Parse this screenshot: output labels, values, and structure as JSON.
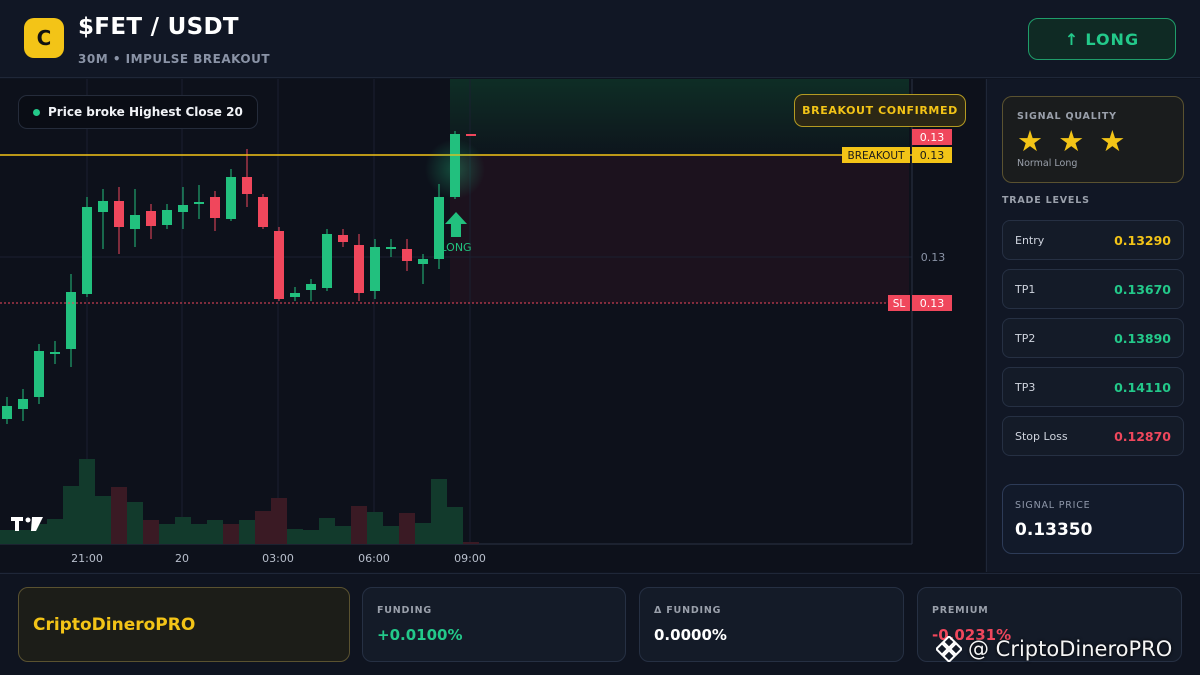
{
  "header": {
    "logo_letter": "C",
    "pair": "$FET / USDT",
    "subtitle": "30M • IMPULSE BREAKOUT",
    "long_button": "LONG",
    "long_icon": "arrow-up-icon"
  },
  "chart": {
    "signal_pill": "Price broke Highest Close 20",
    "breakout_badge": "BREAKOUT CONFIRMED",
    "long_marker_label": "LONG",
    "level_tags": {
      "top_price": "0.13",
      "breakout_label": "BREAKOUT",
      "breakout_price": "0.13",
      "mid_price": "0.13",
      "sl_label": "SL",
      "sl_price": "0.13"
    },
    "time_labels": [
      "21:00",
      "20",
      "03:00",
      "06:00",
      "09:00"
    ],
    "watermark_logo": "TV",
    "colors": {
      "up": "#22c07e",
      "down": "#f0475c",
      "breakout": "#f3c417",
      "sl": "#f0475c"
    }
  },
  "signal_quality": {
    "title": "SIGNAL QUALITY",
    "stars": "★ ★ ★",
    "rating": 3,
    "description": "Normal Long"
  },
  "trade_levels": {
    "title": "TRADE LEVELS",
    "items": [
      {
        "label": "Entry",
        "value": "0.13290",
        "color": "#f3c417"
      },
      {
        "label": "TP1",
        "value": "0.13670",
        "color": "#23c98a"
      },
      {
        "label": "TP2",
        "value": "0.13890",
        "color": "#23c98a"
      },
      {
        "label": "TP3",
        "value": "0.14110",
        "color": "#23c98a"
      },
      {
        "label": "Stop Loss",
        "value": "0.12870",
        "color": "#f0475c"
      }
    ]
  },
  "signal_price": {
    "title": "SIGNAL PRICE",
    "value": "0.13350"
  },
  "footer": {
    "brand": "CriptoDineroPRO",
    "funding": {
      "title": "FUNDING",
      "value": "+0.0100%",
      "color": "#23c98a"
    },
    "delta_funding": {
      "title": "Δ FUNDING",
      "value": "0.0000%",
      "color": "#ffffff"
    },
    "premium": {
      "title": "PREMIUM",
      "value": "-0.0231%",
      "color": "#f0475c"
    }
  },
  "watermark": {
    "text": "@ CriptoDineroPRO",
    "icon": "binance-icon"
  }
}
